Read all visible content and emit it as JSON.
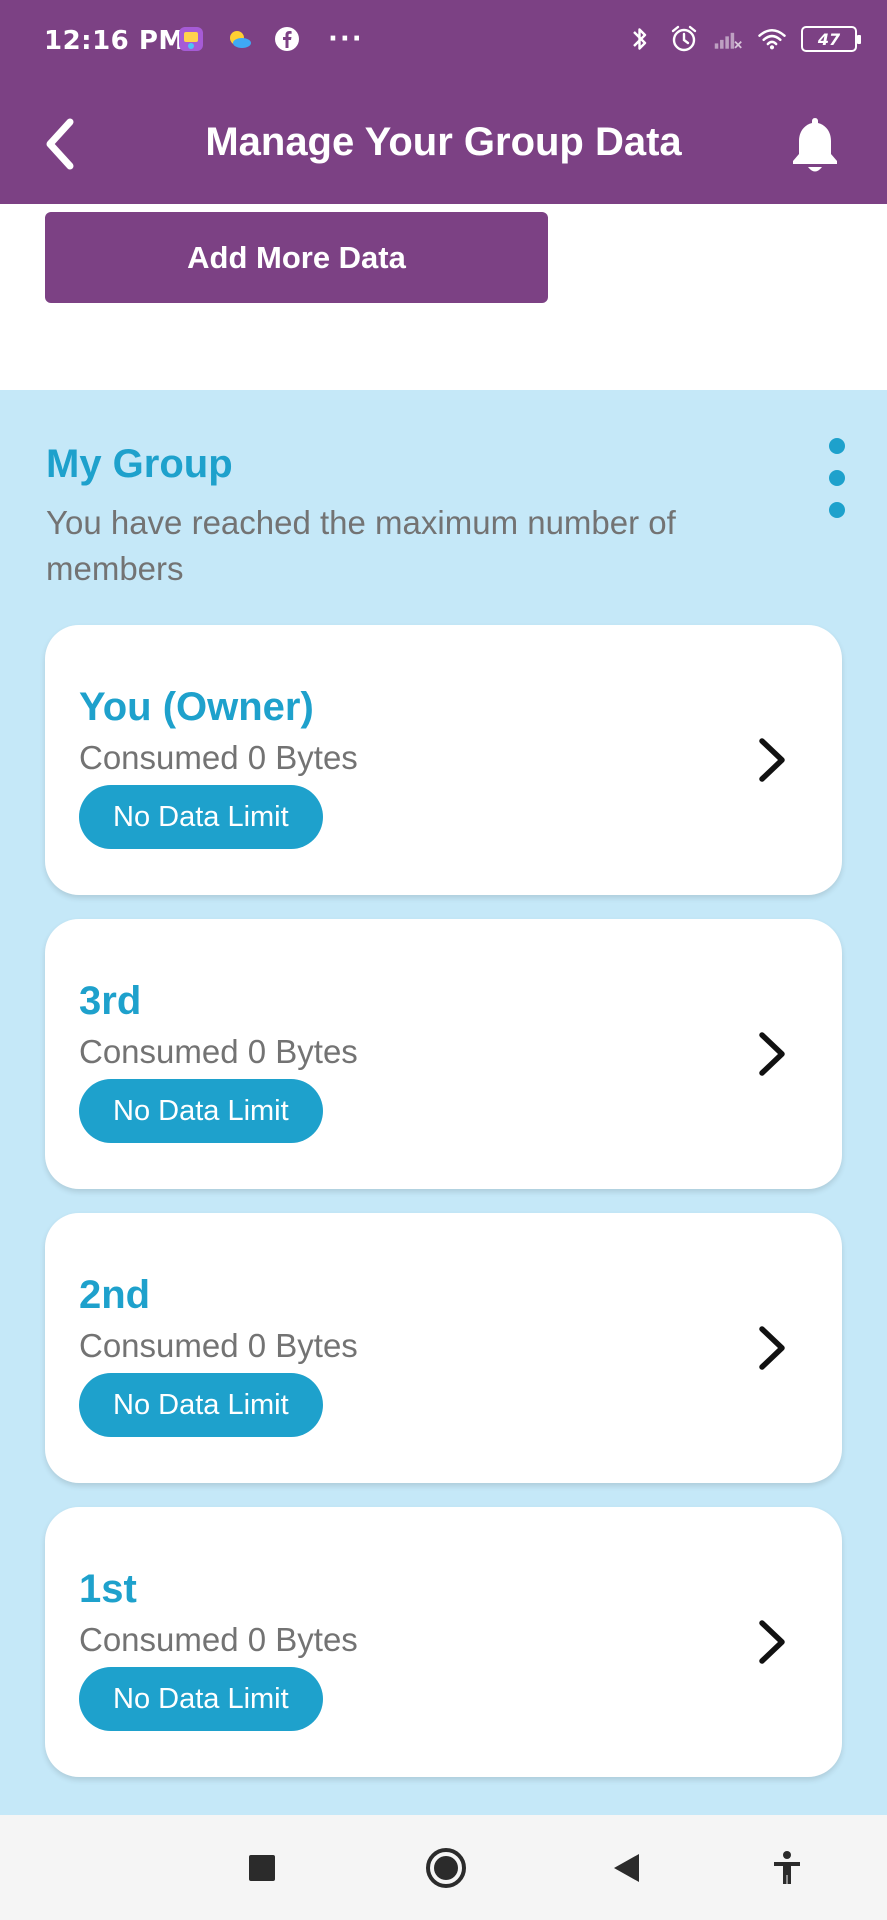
{
  "status_bar": {
    "time": "12:16 PM",
    "more": "···",
    "battery": "47",
    "icons": [
      "app-icon",
      "weather-icon",
      "facebook-icon",
      "bluetooth-icon",
      "alarm-icon",
      "signal-icon",
      "wifi-icon",
      "battery-icon"
    ]
  },
  "header": {
    "title": "Manage Your Group Data",
    "back_icon": "chevron-left-icon",
    "bell_icon": "bell-icon"
  },
  "add_more": {
    "label": "Add More Data"
  },
  "group": {
    "title": "My Group",
    "subtitle": "You have reached the maximum number of members",
    "members": [
      {
        "name": "You (Owner)",
        "consumed": "Consumed 0 Bytes",
        "badge": "No Data Limit"
      },
      {
        "name": "3rd",
        "consumed": "Consumed 0 Bytes",
        "badge": "No Data Limit"
      },
      {
        "name": "2nd",
        "consumed": "Consumed 0 Bytes",
        "badge": "No Data Limit"
      },
      {
        "name": "1st",
        "consumed": "Consumed 0 Bytes",
        "badge": "No Data Limit"
      }
    ]
  },
  "nav": {
    "icons": [
      "recents-square-icon",
      "home-circle-icon",
      "back-triangle-icon",
      "accessibility-icon"
    ]
  },
  "colors": {
    "primary": "#7c4184",
    "accent": "#1ea1cc",
    "group_bg": "#c5e8f8",
    "muted_text": "#737373"
  }
}
